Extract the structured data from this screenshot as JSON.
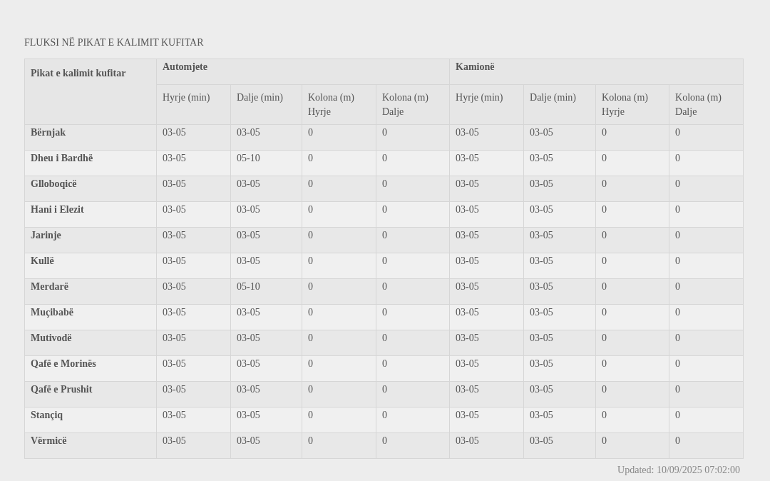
{
  "title": "FLUKSI NË PIKAT E KALIMIT KUFITAR",
  "table": {
    "first_column": "Pikat e kalimit kufitar",
    "groups": [
      {
        "label": "Automjete",
        "columns": [
          "Hyrje (min)",
          "Dalje (min)",
          "Kolona (m) Hyrje",
          "Kolona (m) Dalje"
        ]
      },
      {
        "label": "Kamionë",
        "columns": [
          "Hyrje (min)",
          "Dalje (min)",
          "Kolona (m) Hyrje",
          "Kolona (m) Dalje"
        ]
      }
    ],
    "rows": [
      {
        "name": "Bërnjak",
        "cells": [
          "03-05",
          "03-05",
          "0",
          "0",
          "03-05",
          "03-05",
          "0",
          "0"
        ]
      },
      {
        "name": "Dheu i Bardhë",
        "cells": [
          "03-05",
          "05-10",
          "0",
          "0",
          "03-05",
          "03-05",
          "0",
          "0"
        ]
      },
      {
        "name": "Glloboqicë",
        "cells": [
          "03-05",
          "03-05",
          "0",
          "0",
          "03-05",
          "03-05",
          "0",
          "0"
        ]
      },
      {
        "name": "Hani i Elezit",
        "cells": [
          "03-05",
          "03-05",
          "0",
          "0",
          "03-05",
          "03-05",
          "0",
          "0"
        ]
      },
      {
        "name": "Jarinje",
        "cells": [
          "03-05",
          "03-05",
          "0",
          "0",
          "03-05",
          "03-05",
          "0",
          "0"
        ]
      },
      {
        "name": "Kullë",
        "cells": [
          "03-05",
          "03-05",
          "0",
          "0",
          "03-05",
          "03-05",
          "0",
          "0"
        ]
      },
      {
        "name": "Merdarë",
        "cells": [
          "03-05",
          "05-10",
          "0",
          "0",
          "03-05",
          "03-05",
          "0",
          "0"
        ]
      },
      {
        "name": "Muçibabë",
        "cells": [
          "03-05",
          "03-05",
          "0",
          "0",
          "03-05",
          "03-05",
          "0",
          "0"
        ]
      },
      {
        "name": "Mutivodë",
        "cells": [
          "03-05",
          "03-05",
          "0",
          "0",
          "03-05",
          "03-05",
          "0",
          "0"
        ]
      },
      {
        "name": "Qafë e Morinës",
        "cells": [
          "03-05",
          "03-05",
          "0",
          "0",
          "03-05",
          "03-05",
          "0",
          "0"
        ]
      },
      {
        "name": "Qafë e Prushit",
        "cells": [
          "03-05",
          "03-05",
          "0",
          "0",
          "03-05",
          "03-05",
          "0",
          "0"
        ]
      },
      {
        "name": "Stançiq",
        "cells": [
          "03-05",
          "03-05",
          "0",
          "0",
          "03-05",
          "03-05",
          "0",
          "0"
        ]
      },
      {
        "name": "Vërmicë",
        "cells": [
          "03-05",
          "03-05",
          "0",
          "0",
          "03-05",
          "03-05",
          "0",
          "0"
        ]
      }
    ]
  },
  "updated": "Updated: 10/09/2025 07:02:00"
}
